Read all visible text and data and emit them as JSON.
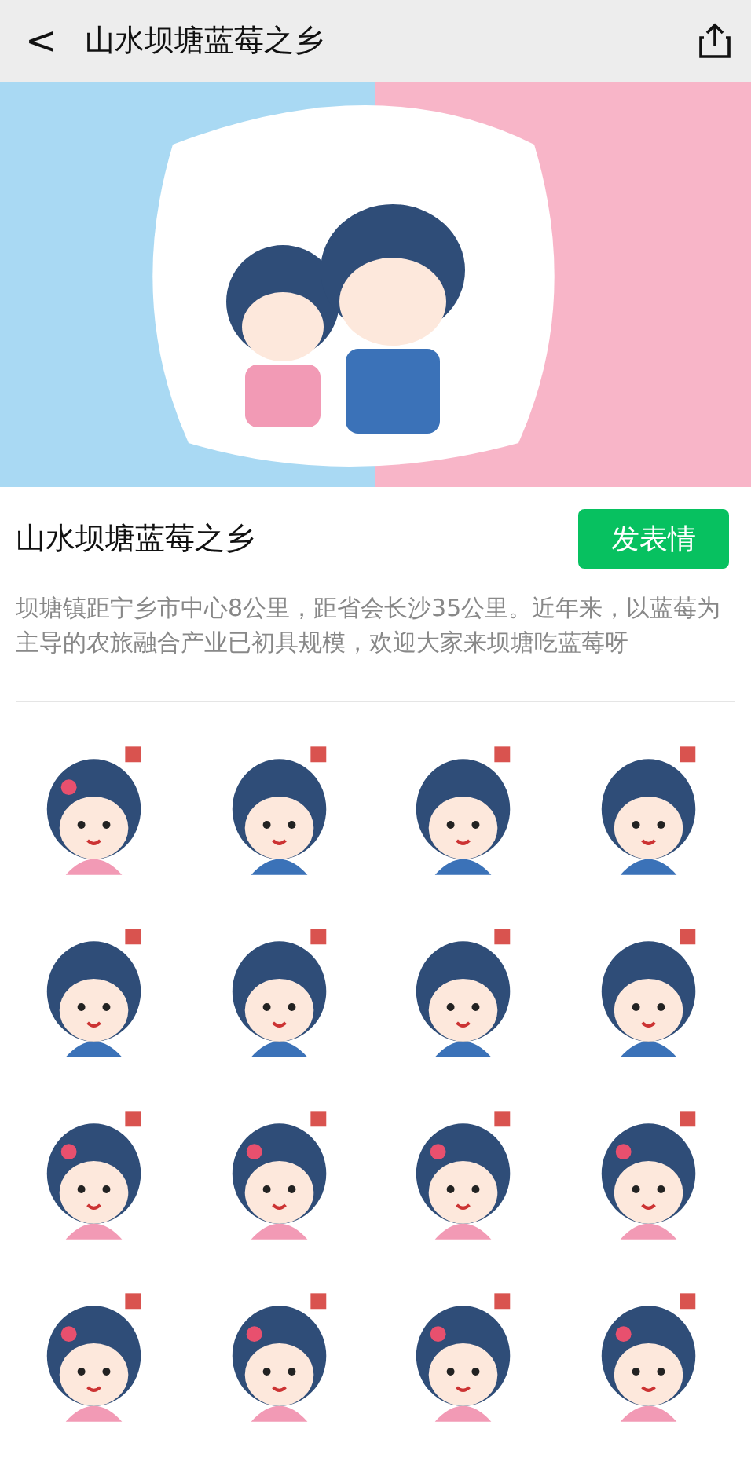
{
  "nav_bar": {
    "back": "<",
    "title": "山水坝塘蓝莓之乡"
  },
  "pack": {
    "title": "山水坝塘蓝莓之乡",
    "button": "发表情",
    "description": "坝塘镇距宁乡市中心8公里，距省会长沙35公里。近年来，以蓝莓为主导的农旅融合产业已初具规模，欢迎大家来坝塘吃蓝莓呀"
  },
  "stickers": [
    {
      "kind": "girl"
    },
    {
      "kind": "boy"
    },
    {
      "kind": "boy"
    },
    {
      "kind": "boy"
    },
    {
      "kind": "boy"
    },
    {
      "kind": "boy"
    },
    {
      "kind": "boy"
    },
    {
      "kind": "boy"
    },
    {
      "kind": "girl"
    },
    {
      "kind": "girl"
    },
    {
      "kind": "girl"
    },
    {
      "kind": "girl"
    },
    {
      "kind": "girl"
    },
    {
      "kind": "girl"
    },
    {
      "kind": "girl"
    },
    {
      "kind": "girl"
    }
  ]
}
